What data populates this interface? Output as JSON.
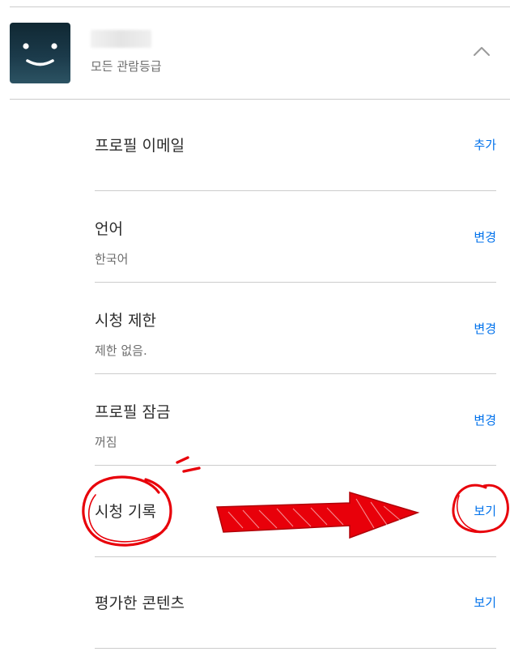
{
  "profile": {
    "maturity_rating": "모든 관람등급"
  },
  "settings": [
    {
      "title": "프로필 이메일",
      "subtitle": "",
      "action": "추가"
    },
    {
      "title": "언어",
      "subtitle": "한국어",
      "action": "변경"
    },
    {
      "title": "시청 제한",
      "subtitle": "제한 없음.",
      "action": "변경"
    },
    {
      "title": "프로필 잠금",
      "subtitle": "꺼짐",
      "action": "변경"
    },
    {
      "title": "시청 기록",
      "subtitle": "",
      "action": "보기"
    },
    {
      "title": "평가한 콘텐츠",
      "subtitle": "",
      "action": "보기"
    }
  ],
  "colors": {
    "link": "#0071eb",
    "annotation": "#e8000a",
    "divider": "#cccccc"
  },
  "icons": {
    "avatar": "smiley-avatar-icon",
    "collapse": "chevron-up-icon"
  }
}
